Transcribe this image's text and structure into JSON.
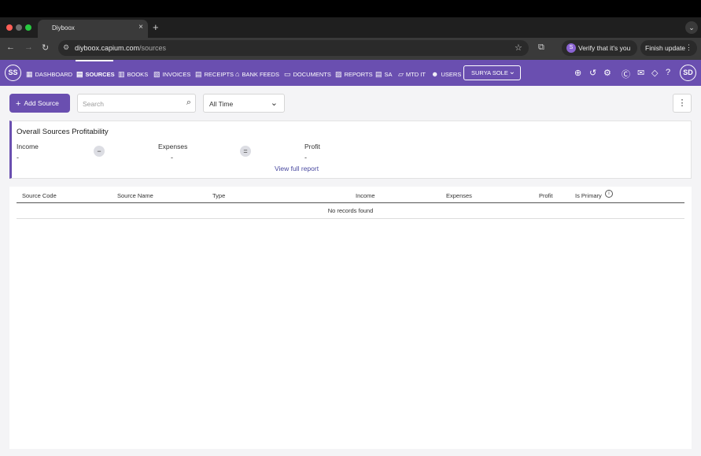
{
  "browser": {
    "tab_title": "Diyboox",
    "tab_close": "×",
    "new_tab": "+",
    "url_host": "diyboox.capium.com",
    "url_path": "/sources",
    "verify_label": "Verify that it's you",
    "finish_update_label": "Finish update"
  },
  "appnav": {
    "user_initials": "SS",
    "items": [
      {
        "label": "DASHBOARD",
        "icon": "dashboard-icon"
      },
      {
        "label": "SOURCES",
        "icon": "sources-icon"
      },
      {
        "label": "BOOKS",
        "icon": "books-icon"
      },
      {
        "label": "INVOICES",
        "icon": "invoices-icon"
      },
      {
        "label": "RECEIPTS",
        "icon": "receipts-icon"
      },
      {
        "label": "BANK FEEDS",
        "icon": "bank-icon"
      },
      {
        "label": "DOCUMENTS",
        "icon": "documents-icon"
      },
      {
        "label": "REPORTS",
        "icon": "reports-icon"
      },
      {
        "label": "SA",
        "icon": "sa-icon"
      },
      {
        "label": "MTD IT",
        "icon": "mtd-icon"
      },
      {
        "label": "USERS",
        "icon": "users-icon"
      }
    ],
    "company_label": "SURYA SOLE",
    "profile_initials": "SD"
  },
  "toolbar": {
    "add_source_label": "Add Source",
    "search_placeholder": "Search",
    "period_value": "All Time"
  },
  "summary": {
    "title": "Overall Sources Profitability",
    "income_label": "Income",
    "income_value": "-",
    "expenses_label": "Expenses",
    "expenses_value": "-",
    "profit_label": "Profit",
    "profit_value": "-",
    "minus_op": "−",
    "equals_op": "=",
    "full_report_link": "View full report"
  },
  "table": {
    "columns": [
      "Source Code",
      "Source Name",
      "Type",
      "Income",
      "Expenses",
      "Profit",
      "Is Primary"
    ],
    "empty_message": "No records found"
  }
}
